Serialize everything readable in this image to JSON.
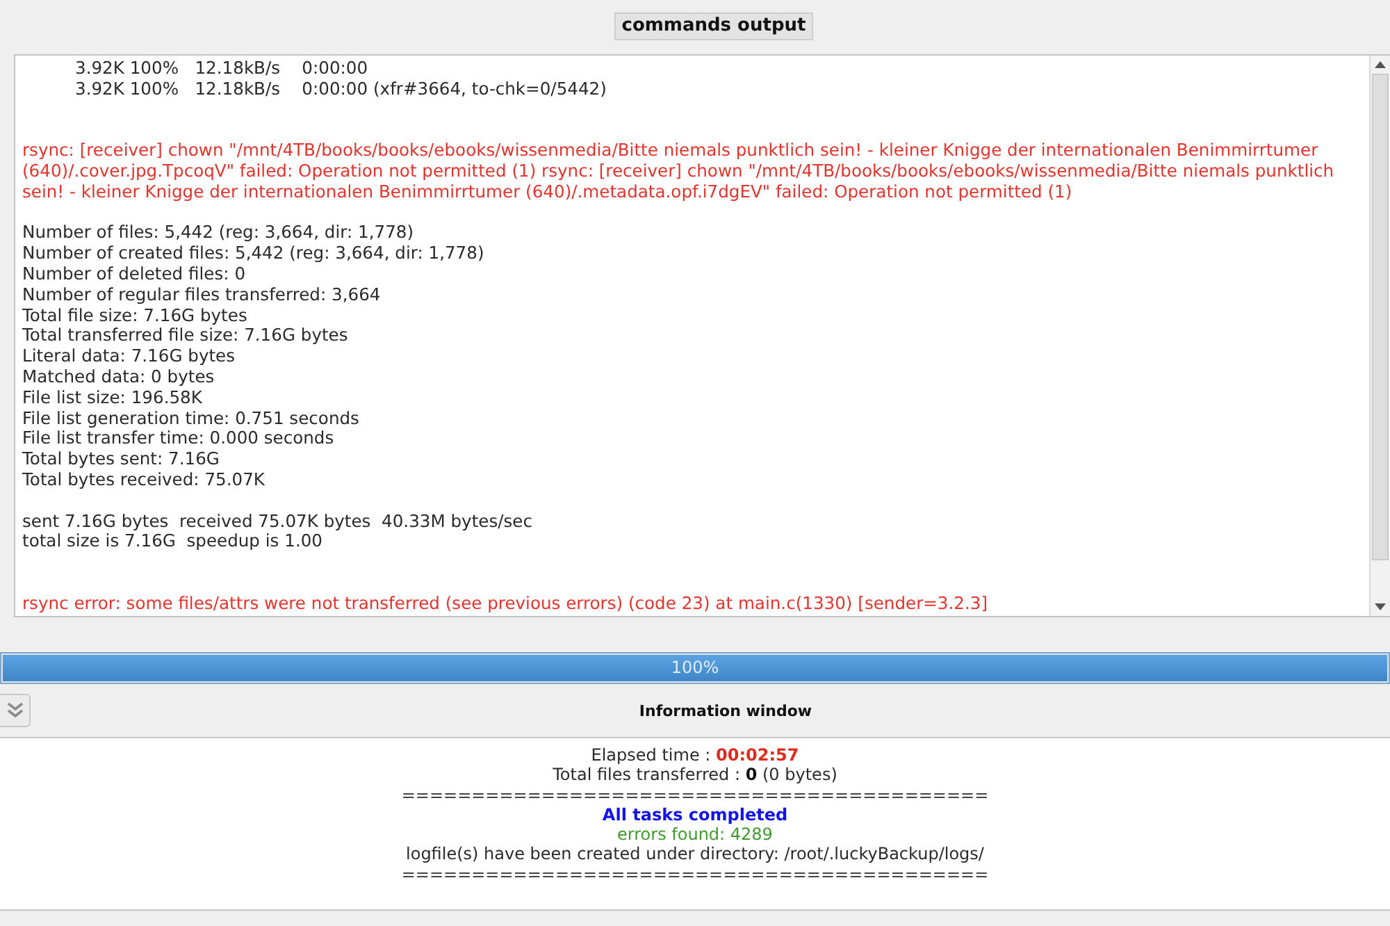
{
  "output_panel": {
    "title": "commands output",
    "log": [
      {
        "kind": "progress",
        "lines": [
          "3.92K 100%   12.18kB/s    0:00:00",
          "3.92K 100%   12.18kB/s    0:00:00 (xfr#3664, to-chk=0/5442)"
        ]
      },
      {
        "kind": "error",
        "lines": [
          "rsync: [receiver] chown \"/mnt/4TB/books/books/ebooks/wissenmedia/Bitte niemals punktlich sein! - kleiner Knigge der internationalen Benimmirrtumer (640)/.cover.jpg.TpcoqV\" failed: Operation not permitted (1) rsync: [receiver] chown \"/mnt/4TB/books/books/ebooks/wissenmedia/Bitte niemals punktlich sein! - kleiner Knigge der internationalen Benimmirrtumer (640)/.metadata.opf.i7dgEV\" failed: Operation not permitted (1)"
        ]
      },
      {
        "kind": "stats",
        "lines": [
          "Number of files: 5,442 (reg: 3,664, dir: 1,778)",
          "Number of created files: 5,442 (reg: 3,664, dir: 1,778)",
          "Number of deleted files: 0",
          "Number of regular files transferred: 3,664",
          "Total file size: 7.16G bytes",
          "Total transferred file size: 7.16G bytes",
          "Literal data: 7.16G bytes",
          "Matched data: 0 bytes",
          "File list size: 196.58K",
          "File list generation time: 0.751 seconds",
          "File list transfer time: 0.000 seconds",
          "Total bytes sent: 7.16G",
          "Total bytes received: 75.07K"
        ]
      },
      {
        "kind": "stats",
        "lines": [
          "sent 7.16G bytes  received 75.07K bytes  40.33M bytes/sec",
          "total size is 7.16G  speedup is 1.00"
        ]
      },
      {
        "kind": "error",
        "lines": [
          "rsync error: some files/attrs were not transferred (see previous errors) (code 23) at main.c(1330) [sender=3.2.3]"
        ]
      }
    ]
  },
  "progress": {
    "level": 1,
    "label": "100%"
  },
  "info_panel": {
    "title": "Information window",
    "lines": [
      {
        "kind": "time",
        "text": "Elapsed time : **00:02:57**"
      },
      {
        "kind": "plain",
        "text": "Total files transferred : **0** (0 bytes)"
      },
      {
        "kind": "separator",
        "text": "=========================================="
      },
      {
        "kind": "status",
        "text": "All tasks completed"
      },
      {
        "kind": "errors",
        "text": "errors found: 4289"
      },
      {
        "kind": "plain",
        "text": "logfile(s) have been created under directory: /root/.luckyBackup/logs/"
      },
      {
        "kind": "separator",
        "text": "=========================================="
      }
    ]
  }
}
